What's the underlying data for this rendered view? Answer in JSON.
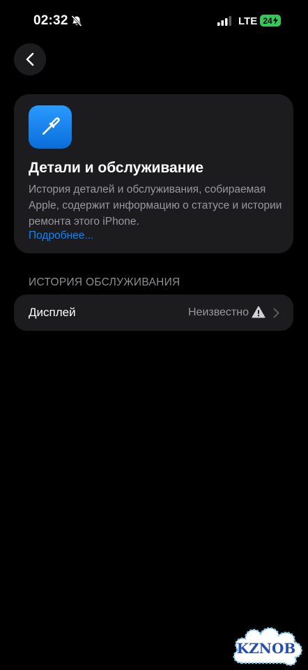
{
  "status_bar": {
    "time": "02:32",
    "network": "LTE",
    "battery": "24",
    "icons": [
      "bell-slash-icon",
      "signal-icon",
      "charging-bolt-icon"
    ]
  },
  "nav": {
    "back_icon": "chevron-left-icon"
  },
  "info_card": {
    "icon": "screwdriver-icon",
    "title": "Детали и обслуживание",
    "description": "История деталей и обслуживания, собираемая Apple, содержит информацию о статусе и истории ремонта этого iPhone.",
    "link": "Подробнее..."
  },
  "service_history": {
    "header": "ИСТОРИЯ ОБСЛУЖИВАНИЯ",
    "items": [
      {
        "label": "Дисплей",
        "value": "Неизвестно",
        "status_icon": "warning-triangle-icon"
      }
    ]
  },
  "watermark": {
    "text": "KZNOB"
  },
  "colors": {
    "background": "#000000",
    "card": "#1c1c1e",
    "accent": "#0a84ff",
    "battery": "#34c759",
    "secondary_text": "#98989f"
  }
}
